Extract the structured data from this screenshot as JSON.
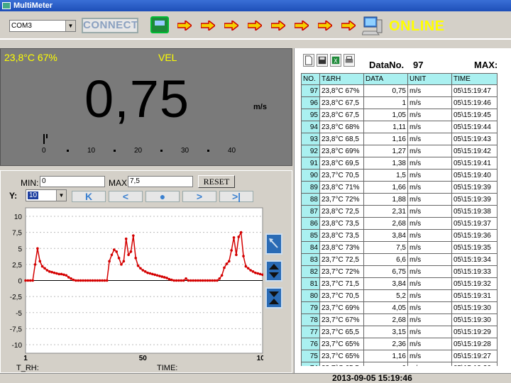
{
  "window": {
    "title": "MultiMeter"
  },
  "toolbar": {
    "com_port": "COM3",
    "connect_label": "CONNECT",
    "status": "ONLINE"
  },
  "display": {
    "env_reading": "23,8°C 67%",
    "mode": "VEL",
    "value": "0,75",
    "unit": "m/s",
    "scale": [
      "0",
      "10",
      "20",
      "30",
      "40"
    ]
  },
  "graph": {
    "min_label": "MIN:",
    "min_value": "0",
    "max_label": "MAX",
    "max_value": "7,5",
    "reset_label": "RESET",
    "y_label": "Y:",
    "y_value": "10",
    "t_rh_label": "T_RH:",
    "time_label": "TIME:"
  },
  "chart_data": {
    "type": "line",
    "x_ticks": [
      "1",
      "50",
      "100"
    ],
    "y_ticks": [
      "10",
      "7,5",
      "5",
      "2,5",
      "0",
      "-2,5",
      "-5",
      "-7,5",
      "-10"
    ],
    "xlim": [
      1,
      100
    ],
    "ylim": [
      -10,
      10
    ],
    "grid": true,
    "color": "#d40000",
    "values": [
      0,
      0,
      0,
      0,
      2.5,
      5,
      3,
      2.2,
      1.9,
      1.6,
      1.4,
      1.3,
      1.2,
      1.1,
      1.0,
      1.0,
      0.9,
      0.8,
      0.5,
      0.3,
      0.1,
      0,
      0,
      0,
      0,
      0,
      0,
      0,
      0,
      0,
      0,
      0,
      0,
      0,
      0,
      3,
      4,
      4.8,
      4.5,
      3.5,
      2.5,
      3,
      6.5,
      4,
      4.5,
      7,
      3.5,
      2.3,
      1.9,
      1.6,
      1.4,
      1.2,
      1.1,
      1.0,
      0.9,
      0.8,
      0.7,
      0.6,
      0.5,
      0.4,
      0.2,
      0.1,
      0,
      0,
      0,
      0,
      0,
      0.3,
      0,
      0,
      0,
      0,
      0,
      0,
      0,
      0,
      0,
      0,
      0,
      0,
      0,
      0.3,
      0.8,
      2,
      2.6,
      3,
      4.7,
      6.7,
      4,
      6.8,
      7.5,
      3.8,
      2.2,
      1.9,
      1.6,
      1.4,
      1.2,
      1.1,
      1.0,
      0.9,
      0.8
    ]
  },
  "table": {
    "toolbar_label": "DataNo.",
    "data_no": "97",
    "max_label": "MAX:",
    "columns": [
      "NO.",
      "T&RH",
      "DATA",
      "UNIT",
      "TIME"
    ],
    "rows": [
      [
        "97",
        "23,8°C 67%",
        "0,75",
        "m/s",
        "05\\15:19:47"
      ],
      [
        "96",
        "23,8°C 67,5",
        "1",
        "m/s",
        "05\\15:19:46"
      ],
      [
        "95",
        "23,8°C 67,5",
        "1,05",
        "m/s",
        "05\\15:19:45"
      ],
      [
        "94",
        "23,8°C 68%",
        "1,11",
        "m/s",
        "05\\15:19:44"
      ],
      [
        "93",
        "23,8°C 68,5",
        "1,16",
        "m/s",
        "05\\15:19:43"
      ],
      [
        "92",
        "23,8°C 69%",
        "1,27",
        "m/s",
        "05\\15:19:42"
      ],
      [
        "91",
        "23,8°C 69,5",
        "1,38",
        "m/s",
        "05\\15:19:41"
      ],
      [
        "90",
        "23,7°C 70,5",
        "1,5",
        "m/s",
        "05\\15:19:40"
      ],
      [
        "89",
        "23,8°C 71%",
        "1,66",
        "m/s",
        "05\\15:19:39"
      ],
      [
        "88",
        "23,7°C 72%",
        "1,88",
        "m/s",
        "05\\15:19:39"
      ],
      [
        "87",
        "23,8°C 72,5",
        "2,31",
        "m/s",
        "05\\15:19:38"
      ],
      [
        "86",
        "23,8°C 73,5",
        "2,68",
        "m/s",
        "05\\15:19:37"
      ],
      [
        "85",
        "23,8°C 73,5",
        "3,84",
        "m/s",
        "05\\15:19:36"
      ],
      [
        "84",
        "23,8°C 73%",
        "7,5",
        "m/s",
        "05\\15:19:35"
      ],
      [
        "83",
        "23,7°C 72,5",
        "6,6",
        "m/s",
        "05\\15:19:34"
      ],
      [
        "82",
        "23,7°C 72%",
        "6,75",
        "m/s",
        "05\\15:19:33"
      ],
      [
        "81",
        "23,7°C 71,5",
        "3,84",
        "m/s",
        "05\\15:19:32"
      ],
      [
        "80",
        "23,7°C 70,5",
        "5,2",
        "m/s",
        "05\\15:19:31"
      ],
      [
        "79",
        "23,7°C 69%",
        "4,05",
        "m/s",
        "05\\15:19:30"
      ],
      [
        "78",
        "23,7°C 67%",
        "2,68",
        "m/s",
        "05\\15:19:30"
      ],
      [
        "77",
        "23,7°C 65,5",
        "3,15",
        "m/s",
        "05\\15:19:29"
      ],
      [
        "76",
        "23,7°C 65%",
        "2,36",
        "m/s",
        "05\\15:19:28"
      ],
      [
        "75",
        "23,7°C 65%",
        "1,16",
        "m/s",
        "05\\15:19:27"
      ],
      [
        "74",
        "23,7°C 65,5",
        "0",
        "m/s",
        "05\\15:19:26"
      ],
      [
        "73",
        "23,7°C 65%",
        "0",
        "m/s",
        "05\\15:19:25"
      ],
      [
        "72",
        "23,7°C 65%",
        "0",
        "m/s",
        "05\\15:19:24"
      ]
    ]
  },
  "statusbar": {
    "datetime": "2013-09-05 15:19:46"
  }
}
